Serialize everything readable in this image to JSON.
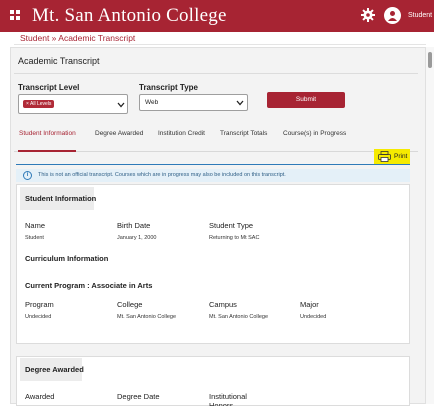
{
  "app": {
    "title": "Mt. San Antonio College",
    "user_label": "Student"
  },
  "breadcrumb": "Student » Academic Transcript",
  "page_title": "Academic Transcript",
  "form": {
    "level_label": "Transcript Level",
    "level_chip": "× All Levels",
    "type_label": "Transcript Type",
    "type_value": "Web",
    "submit_label": "Submit"
  },
  "tabs": [
    {
      "label": "Student Information",
      "active": true
    },
    {
      "label": "Degree Awarded"
    },
    {
      "label": "Institution Credit"
    },
    {
      "label": "Transcript Totals"
    },
    {
      "label": "Course(s) in Progress"
    }
  ],
  "print_label": "Print",
  "notice": "This is not an official transcript. Courses which are in progress may also be included on this transcript.",
  "student_info": {
    "heading": "Student Information",
    "fields": [
      {
        "label": "Name",
        "value": "Student"
      },
      {
        "label": "Birth Date",
        "value": "January 1, 2000"
      },
      {
        "label": "Student Type",
        "value": "Returning to Mt SAC"
      }
    ],
    "curriculum_heading": "Curriculum Information",
    "current_program": "Current Program : Associate in Arts",
    "program_fields": [
      {
        "label": "Program",
        "value": "Undecided"
      },
      {
        "label": "College",
        "value": "Mt. San Antonio College"
      },
      {
        "label": "Campus",
        "value": "Mt. San Antonio College"
      },
      {
        "label": "Major",
        "value": "Undecided"
      }
    ]
  },
  "degree_awarded": {
    "heading": "Degree Awarded",
    "columns": [
      "Awarded",
      "Degree Date",
      "Institutional Honors"
    ]
  },
  "colors": {
    "brand": "#a72433",
    "highlight": "#f5ea00",
    "info": "#2f7ab8"
  },
  "icons": [
    "grid-menu-icon",
    "gear-icon",
    "user-avatar-icon",
    "chevron-down-icon",
    "printer-icon",
    "info-icon"
  ]
}
